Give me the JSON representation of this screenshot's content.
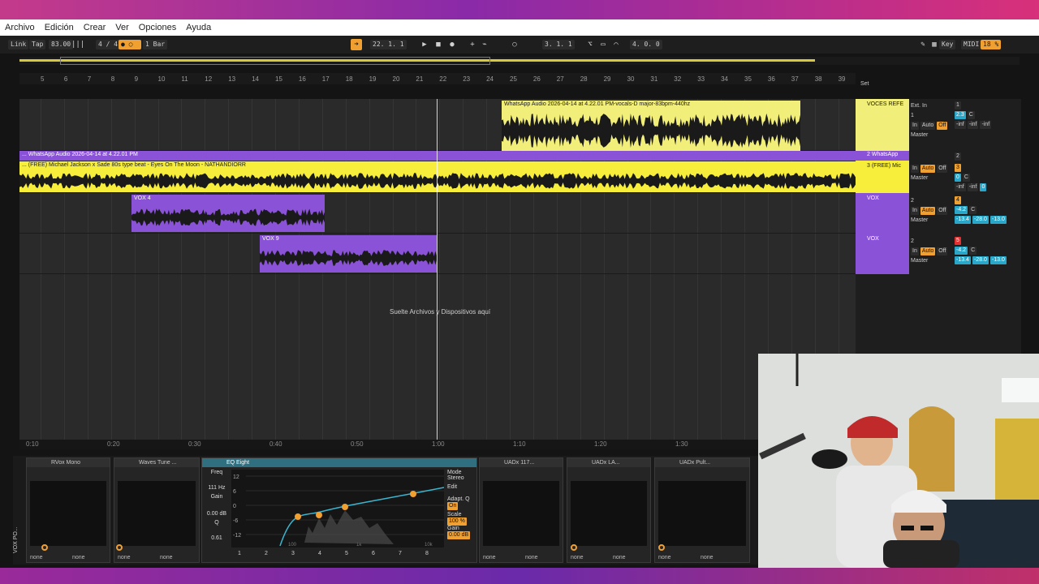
{
  "menu": [
    "Archivo",
    "Edición",
    "Crear",
    "Ver",
    "Opciones",
    "Ayuda"
  ],
  "transport": {
    "link": "Link",
    "tap": "Tap",
    "tempo": "83.00",
    "time_sig": "4 / 4",
    "quantize": "1 Bar",
    "position": "22.  1.  1",
    "loop_start": "3.  1.  1",
    "loop_length": "4.  0.  0",
    "key": "Key",
    "midi": "MIDI",
    "cpu": "18 %"
  },
  "ruler_bars": [
    "5",
    "6",
    "7",
    "8",
    "9",
    "10",
    "11",
    "12",
    "13",
    "14",
    "15",
    "16",
    "17",
    "18",
    "19",
    "20",
    "21",
    "22",
    "23",
    "24",
    "25",
    "26",
    "27",
    "28",
    "29",
    "30",
    "31",
    "32",
    "33",
    "34",
    "35",
    "36",
    "37",
    "38",
    "39"
  ],
  "set_label": "Set",
  "clips": {
    "whatsapp_top": "WhatsApp Audio 2026-04-14 at 4.22.01 PM-vocals-D major-83bpm-440hz",
    "whatsapp_purple": "... WhatsApp Audio 2026-04-14 at 4.22.01 PM",
    "beat": "... (FREE) Michael Jackson x Sade 80s type beat - Eyes On The Moon - NATHANDIORR",
    "vox4": "VOX 4",
    "vox9": "VOX 9"
  },
  "drop_text": "Suelte Archivos y Dispositivos aquí",
  "tracks": [
    {
      "name": "VOCES REFE",
      "input": "Ext. In",
      "channel": "1",
      "monitor": "In",
      "mode": "Auto",
      "off": "Off",
      "out": "Master",
      "num": "1",
      "vol": "2.3",
      "pan": "C",
      "s1": "-inf",
      "s2": "-inf",
      "s3": "-inf"
    },
    {
      "name": "2 WhatsApp",
      "num": "2"
    },
    {
      "name": "3 (FREE) Mic",
      "monitor": "In",
      "mode": "Auto",
      "off": "Off",
      "out": "Master",
      "num": "3",
      "vol": "0",
      "pan": "C",
      "s1": "-inf",
      "s2": "-inf",
      "s3": "0"
    },
    {
      "name": "VOX",
      "channel": "2",
      "monitor": "In",
      "mode": "Auto",
      "off": "Off",
      "out": "Master",
      "num": "4",
      "vol": "-4.2",
      "pan": "C",
      "s1": "-13.4",
      "s2": "-28.0",
      "s3": "-13.0"
    },
    {
      "name": "VOX",
      "channel": "2",
      "monitor": "In",
      "mode": "Auto",
      "off": "Off",
      "out": "Master",
      "num": "5",
      "vol": "-4.2",
      "pan": "C",
      "s1": "-13.4",
      "s2": "-28.0",
      "s3": "-13.0"
    }
  ],
  "time_marks": [
    "0:10",
    "0:20",
    "0:30",
    "0:40",
    "0:50",
    "1:00",
    "1:10",
    "1:20",
    "1:30"
  ],
  "devices": [
    {
      "title": "RVox Mono",
      "sel1": "none",
      "sel2": "none"
    },
    {
      "title": "Waves Tune ...",
      "sel1": "none",
      "sel2": "none"
    },
    {
      "title": "UADx 117...",
      "sel1": "none",
      "sel2": "none"
    },
    {
      "title": "UADx LA...",
      "sel1": "none",
      "sel2": "none"
    },
    {
      "title": "UADx Pult...",
      "sel1": "none",
      "sel2": "none"
    }
  ],
  "eq": {
    "title": "EQ Eight",
    "freq_label": "Freq",
    "freq": "111 Hz",
    "gain_label": "Gain",
    "gain": "0.00 dB",
    "q_label": "Q",
    "q": "0.61",
    "mode_label": "Mode",
    "mode": "Stereo",
    "edit": "Edit",
    "adapt_q": "Adapt. Q",
    "adapt_q_val": "On",
    "scale": "Scale",
    "scale_val": "100 %",
    "gain2": "Gain",
    "gain2_val": "0.00 dB",
    "db_marks": [
      "12",
      "6",
      "0",
      "-6",
      "-12"
    ],
    "freq_marks": [
      "100",
      "1k",
      "10k"
    ],
    "bands": [
      "1",
      "2",
      "3",
      "4",
      "5",
      "6",
      "7",
      "8"
    ]
  },
  "side_label": "VOX PO..."
}
